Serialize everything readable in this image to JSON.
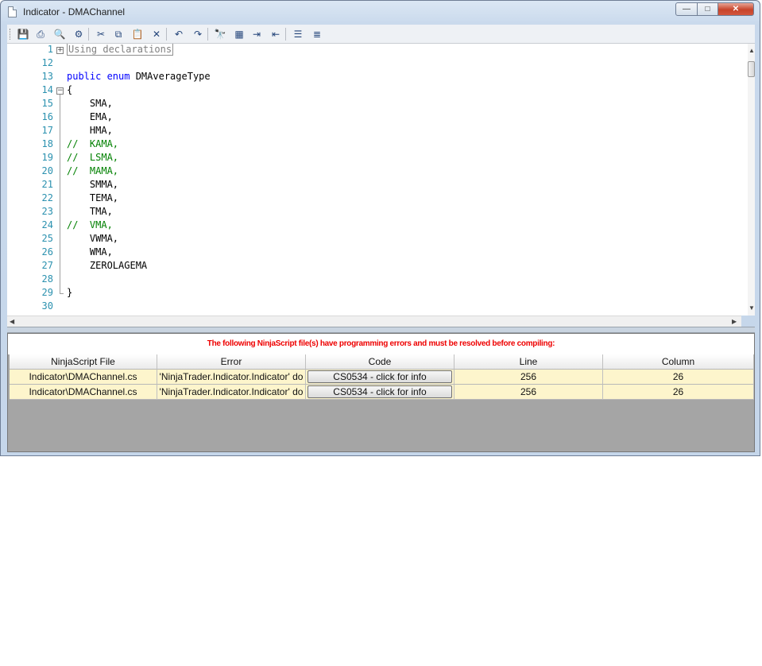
{
  "window": {
    "title": "Indicator - DMAChannel"
  },
  "title_controls": {
    "minimize": "—",
    "maximize": "□",
    "close": "✕"
  },
  "toolbar": [
    {
      "name": "save-icon",
      "glyph": "💾"
    },
    {
      "name": "print-icon",
      "glyph": "⎙"
    },
    {
      "name": "print-preview-icon",
      "glyph": "🔍"
    },
    {
      "name": "properties-icon",
      "glyph": "⚙"
    },
    {
      "name": "cut-icon",
      "glyph": "✂"
    },
    {
      "name": "copy-icon",
      "glyph": "⧉"
    },
    {
      "name": "paste-icon",
      "glyph": "📋"
    },
    {
      "name": "delete-icon",
      "glyph": "✕"
    },
    {
      "name": "undo-icon",
      "glyph": "↶"
    },
    {
      "name": "redo-icon",
      "glyph": "↷"
    },
    {
      "name": "find-icon",
      "glyph": "🔭"
    },
    {
      "name": "replace-icon",
      "glyph": "▦"
    },
    {
      "name": "indent-icon",
      "glyph": "⇥"
    },
    {
      "name": "outdent-icon",
      "glyph": "⇤"
    },
    {
      "name": "comment-icon",
      "glyph": "☰"
    },
    {
      "name": "uncomment-icon",
      "glyph": "≣"
    }
  ],
  "code_lines": [
    {
      "num": "1",
      "fold": "+",
      "parts": [
        {
          "t": "Using declarations",
          "c": "collapsed"
        }
      ]
    },
    {
      "num": "12",
      "parts": []
    },
    {
      "num": "13",
      "parts": [
        {
          "t": "public enum ",
          "c": "kw"
        },
        {
          "t": "DMAverageType",
          "c": "plain"
        }
      ]
    },
    {
      "num": "14",
      "fold": "-",
      "parts": [
        {
          "t": "{",
          "c": "plain"
        }
      ]
    },
    {
      "num": "15",
      "parts": [
        {
          "t": "    SMA,",
          "c": "plain"
        }
      ]
    },
    {
      "num": "16",
      "parts": [
        {
          "t": "    EMA,",
          "c": "plain"
        }
      ]
    },
    {
      "num": "17",
      "parts": [
        {
          "t": "    HMA,",
          "c": "plain"
        }
      ]
    },
    {
      "num": "18",
      "parts": [
        {
          "t": "//  KAMA,",
          "c": "comment"
        }
      ]
    },
    {
      "num": "19",
      "parts": [
        {
          "t": "//  LSMA,",
          "c": "comment"
        }
      ]
    },
    {
      "num": "20",
      "parts": [
        {
          "t": "//  MAMA,",
          "c": "comment"
        }
      ]
    },
    {
      "num": "21",
      "parts": [
        {
          "t": "    SMMA,",
          "c": "plain"
        }
      ]
    },
    {
      "num": "22",
      "parts": [
        {
          "t": "    TEMA,",
          "c": "plain"
        }
      ]
    },
    {
      "num": "23",
      "parts": [
        {
          "t": "    TMA,",
          "c": "plain"
        }
      ]
    },
    {
      "num": "24",
      "parts": [
        {
          "t": "//  VMA,",
          "c": "comment"
        }
      ]
    },
    {
      "num": "25",
      "parts": [
        {
          "t": "    VWMA,",
          "c": "plain"
        }
      ]
    },
    {
      "num": "26",
      "parts": [
        {
          "t": "    WMA,",
          "c": "plain"
        }
      ]
    },
    {
      "num": "27",
      "parts": [
        {
          "t": "    ZEROLAGEMA",
          "c": "plain"
        }
      ]
    },
    {
      "num": "28",
      "parts": []
    },
    {
      "num": "29",
      "fold_end": true,
      "parts": [
        {
          "t": "}",
          "c": "plain"
        }
      ]
    },
    {
      "num": "30",
      "parts": []
    }
  ],
  "errors": {
    "message": "The following NinjaScript file(s) have programming errors and must be resolved before compiling:",
    "columns": [
      "NinjaScript File",
      "Error",
      "Code",
      "Line",
      "Column"
    ],
    "rows": [
      {
        "file": "Indicator\\DMAChannel.cs",
        "error": "'NinjaTrader.Indicator.Indicator' do",
        "code": "CS0534 - click for info",
        "line": "256",
        "column": "26"
      },
      {
        "file": "Indicator\\DMAChannel.cs",
        "error": "'NinjaTrader.Indicator.Indicator' do",
        "code": "CS0534 - click for info",
        "line": "256",
        "column": "26"
      }
    ]
  }
}
